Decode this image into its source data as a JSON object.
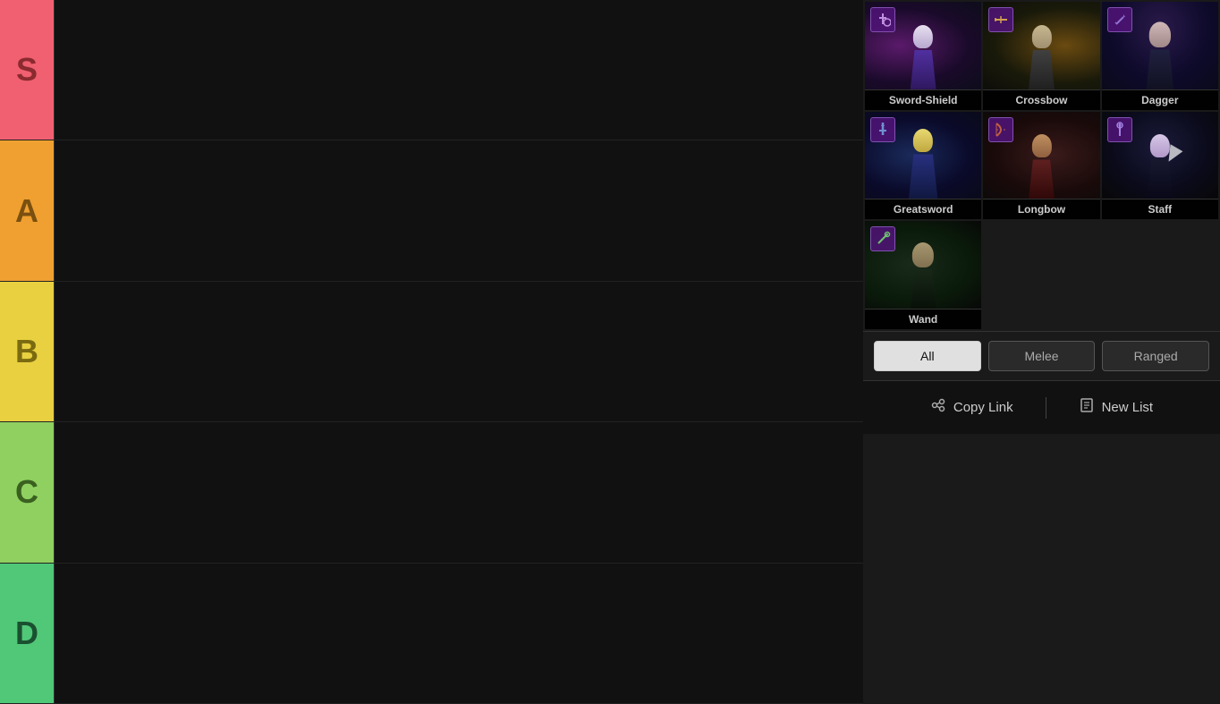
{
  "tiers": [
    {
      "id": "s",
      "label": "S",
      "color": "#f06070"
    },
    {
      "id": "a",
      "label": "A",
      "color": "#f0a030"
    },
    {
      "id": "b",
      "label": "B",
      "color": "#e8d040"
    },
    {
      "id": "c",
      "label": "C",
      "color": "#90d060"
    },
    {
      "id": "d",
      "label": "D",
      "color": "#50c878"
    }
  ],
  "weapons": [
    {
      "id": "sword-shield",
      "name": "Sword-Shield",
      "type": "melee"
    },
    {
      "id": "crossbow",
      "name": "Crossbow",
      "type": "ranged"
    },
    {
      "id": "dagger",
      "name": "Dagger",
      "type": "melee"
    },
    {
      "id": "greatsword",
      "name": "Greatsword",
      "type": "melee"
    },
    {
      "id": "longbow",
      "name": "Longbow",
      "type": "ranged"
    },
    {
      "id": "staff",
      "name": "Staff",
      "type": "ranged"
    },
    {
      "id": "wand",
      "name": "Wand",
      "type": "ranged"
    }
  ],
  "filters": [
    {
      "id": "all",
      "label": "All",
      "active": true
    },
    {
      "id": "melee",
      "label": "Melee",
      "active": false
    },
    {
      "id": "ranged",
      "label": "Ranged",
      "active": false
    }
  ],
  "actions": {
    "copy_link": "Copy Link",
    "new_list": "New List"
  }
}
